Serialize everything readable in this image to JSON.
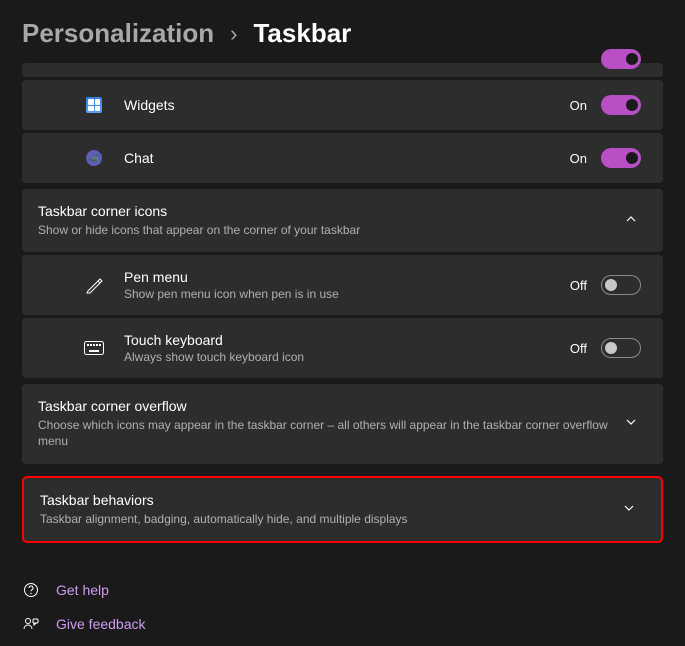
{
  "breadcrumb": {
    "parent": "Personalization",
    "current": "Taskbar"
  },
  "items": {
    "widgets": {
      "label": "Widgets",
      "state": "On"
    },
    "chat": {
      "label": "Chat",
      "state": "On"
    },
    "pen": {
      "label": "Pen menu",
      "desc": "Show pen menu icon when pen is in use",
      "state": "Off"
    },
    "touch": {
      "label": "Touch keyboard",
      "desc": "Always show touch keyboard icon",
      "state": "Off"
    }
  },
  "sections": {
    "cornerIcons": {
      "title": "Taskbar corner icons",
      "desc": "Show or hide icons that appear on the corner of your taskbar"
    },
    "overflow": {
      "title": "Taskbar corner overflow",
      "desc": "Choose which icons may appear in the taskbar corner – all others will appear in the taskbar corner overflow menu"
    },
    "behaviors": {
      "title": "Taskbar behaviors",
      "desc": "Taskbar alignment, badging, automatically hide, and multiple displays"
    }
  },
  "footer": {
    "help": "Get help",
    "feedback": "Give feedback"
  }
}
